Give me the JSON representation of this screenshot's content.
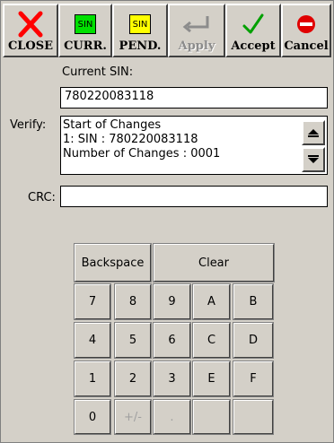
{
  "toolbar": {
    "close_label": "CLOSE",
    "curr_label": "CURR.",
    "curr_icon_text": "SIN",
    "pend_label": "PEND.",
    "pend_icon_text": "SIN",
    "apply_label": "Apply",
    "accept_label": "Accept",
    "cancel_label": "Cancel"
  },
  "form": {
    "current_sin_label": "Current SIN:",
    "current_sin_value": "780220083118",
    "verify_label": "Verify:",
    "verify_lines": [
      "Start of Changes",
      "1: SIN : 780220083118",
      "Number of Changes : 0001"
    ],
    "crc_label": "CRC:",
    "crc_value": ""
  },
  "keypad": {
    "backspace": "Backspace",
    "clear": "Clear",
    "keys": [
      "7",
      "8",
      "9",
      "A",
      "B",
      "4",
      "5",
      "6",
      "C",
      "D",
      "1",
      "2",
      "3",
      "E",
      "F",
      "0",
      "+/-",
      ".",
      "",
      ""
    ]
  },
  "colors": {
    "close_x": "#ff0000",
    "curr_box": "#00e000",
    "pend_box": "#ffff00",
    "accept_check": "#00a000",
    "cancel_icon": "#e00000",
    "background": "#d4d0c8"
  },
  "icons": [
    "close-x-icon",
    "sin-current-icon",
    "sin-pending-icon",
    "enter-arrow-icon",
    "checkmark-icon",
    "no-entry-icon",
    "scroll-up-icon",
    "scroll-down-icon"
  ]
}
